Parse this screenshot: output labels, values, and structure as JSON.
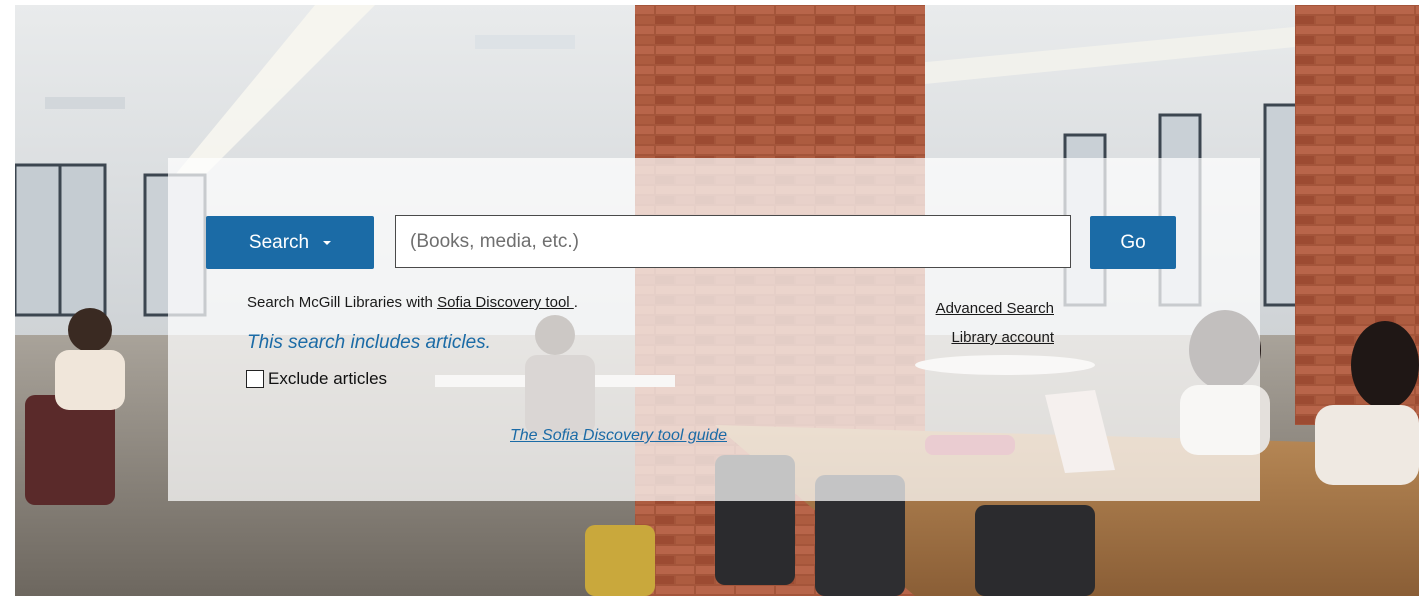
{
  "search": {
    "scope_button_label": "Search",
    "placeholder": "(Books, media, etc.)",
    "go_label": "Go"
  },
  "description": {
    "prefix": "Search McGill Libraries with ",
    "link_text": "Sofia Discovery tool ",
    "suffix": "."
  },
  "includes_note": "This search includes articles.",
  "exclude_articles_label": "Exclude articles",
  "links": {
    "advanced_search": "Advanced Search",
    "library_account": "Library account"
  },
  "guide_link": "The Sofia Discovery tool guide",
  "colors": {
    "accent": "#1b6ba6",
    "panel_overlay": "rgba(255,255,255,0.72)"
  },
  "icons": {
    "scope_dropdown": "caret-down-icon"
  }
}
